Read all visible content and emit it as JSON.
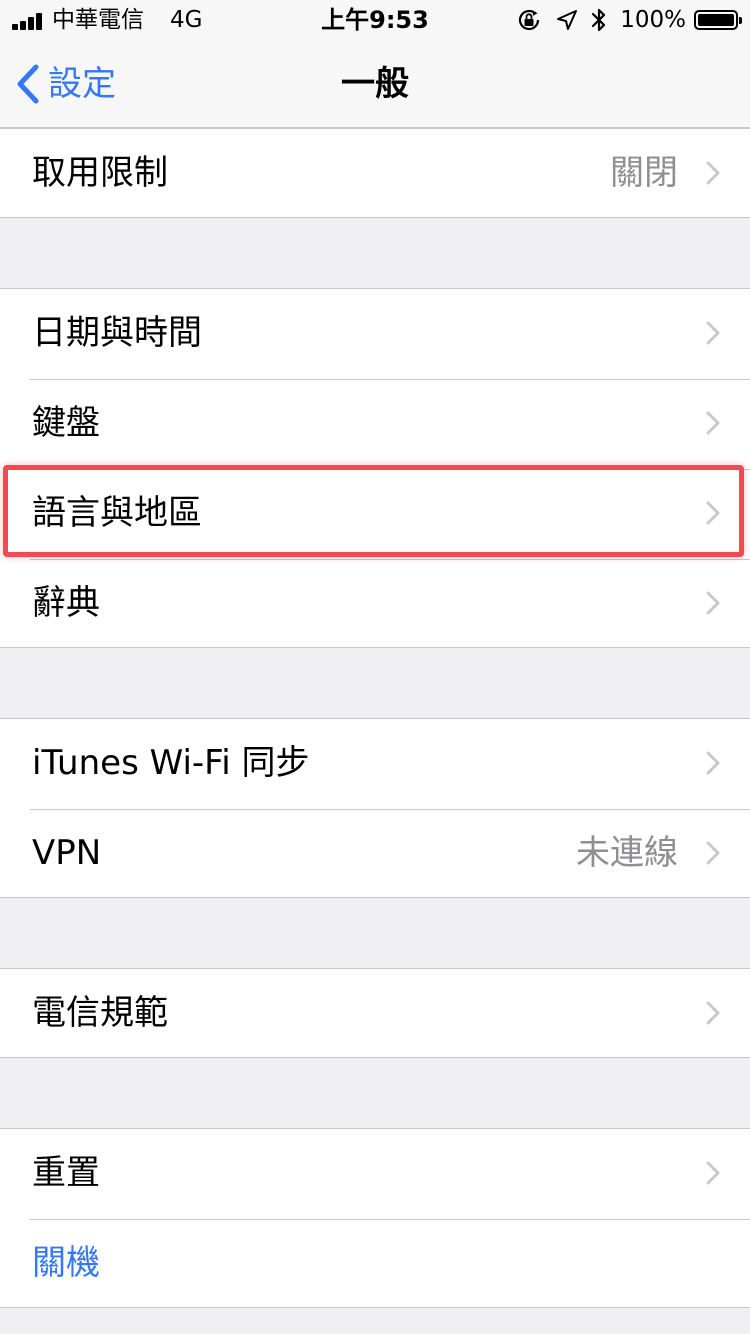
{
  "status_bar": {
    "carrier": "中華電信",
    "network": "4G",
    "time": "上午9:53",
    "battery_percent": "100%",
    "battery_level": 1.0
  },
  "nav": {
    "back_label": "設定",
    "title": "一般"
  },
  "sections": {
    "restrictions": {
      "label": "取用限制",
      "value": "關閉"
    },
    "date_time": {
      "label": "日期與時間"
    },
    "keyboard": {
      "label": "鍵盤"
    },
    "language_region": {
      "label": "語言與地區"
    },
    "dictionary": {
      "label": "辭典"
    },
    "itunes_wifi_sync": {
      "label": "iTunes Wi-Fi 同步"
    },
    "vpn": {
      "label": "VPN",
      "value": "未連線"
    },
    "regulatory": {
      "label": "電信規範"
    },
    "reset": {
      "label": "重置"
    },
    "shutdown": {
      "label": "關機"
    }
  },
  "colors": {
    "accent": "#3478f6",
    "background": "#efeff4",
    "highlight": "#f24a50",
    "secondary_text": "#8e8e93"
  },
  "icons": {
    "signal": "cellular-signal-icon",
    "lock_rotation": "orientation-lock-icon",
    "location": "location-arrow-icon",
    "bluetooth": "bluetooth-icon",
    "battery": "battery-icon",
    "back": "chevron-left-icon",
    "disclosure": "chevron-right-icon"
  }
}
